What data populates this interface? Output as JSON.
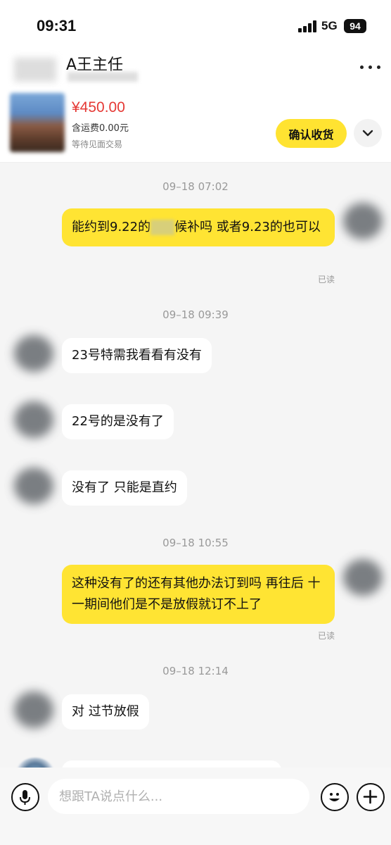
{
  "status_bar": {
    "time": "09:31",
    "network": "5G",
    "battery": "94"
  },
  "header": {
    "title": "A王主任"
  },
  "product": {
    "price": "¥450.00",
    "shipping": "含运费0.00元",
    "status": "等待见面交易",
    "confirm_label": "确认收货"
  },
  "messages": {
    "ts1": "09–18 07:02",
    "m1_part1": "能约到9.22的",
    "m1_part2": "候补吗 或者9.23的也可以",
    "read1": "已读",
    "ts2": "09–18 09:39",
    "m2": "23号特需我看看有没有",
    "m3": "22号的是没有了",
    "m4": "没有了 只能是直约",
    "ts3": "09–18 10:55",
    "m5": "这种没有了的还有其他办法订到吗 再往后 十一期间他们是不是放假就订不上了",
    "read2": "已读",
    "ts4": "09–18 12:14",
    "m6": "对 过节放假"
  },
  "input": {
    "placeholder": "想跟TA说点什么..."
  },
  "colors": {
    "accent_yellow": "#ffe433",
    "price_red": "#e53935"
  }
}
